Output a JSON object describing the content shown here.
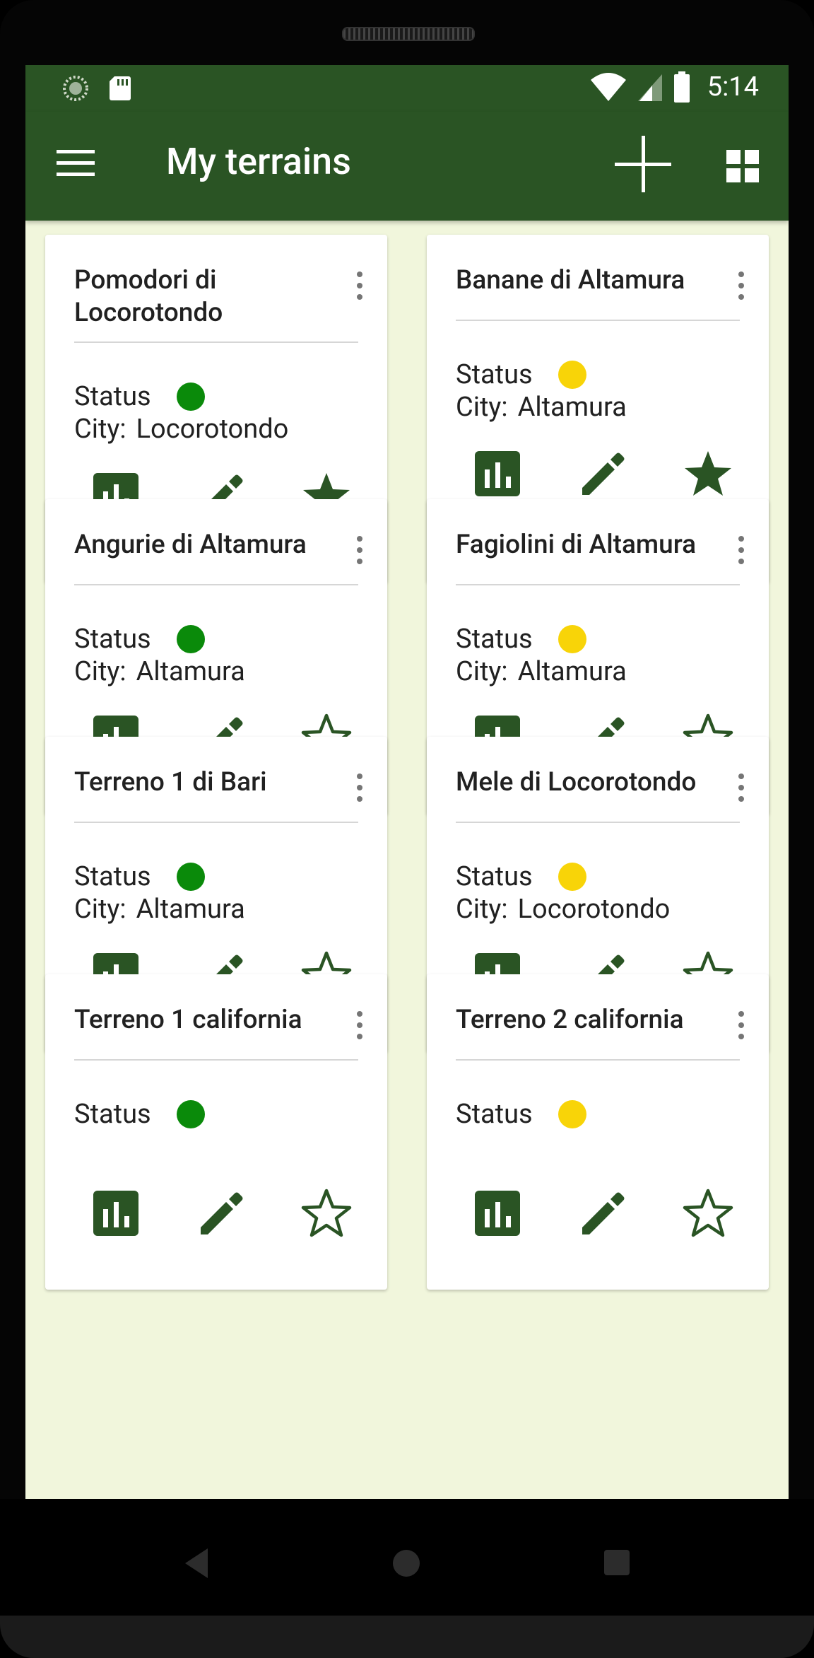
{
  "statusbar": {
    "time": "5:14"
  },
  "appbar": {
    "title": "My terrains"
  },
  "colors": {
    "primary": "#2a5424",
    "background": "#f1f6dc",
    "status_green": "#0a8a0a",
    "status_yellow": "#f8d408",
    "icon": "#2a5424"
  },
  "labels": {
    "status": "Status",
    "city": "City:"
  },
  "terrains": [
    {
      "title": "Pomodori di Locorotondo",
      "status": "green",
      "city": "Locorotondo",
      "favorite": true
    },
    {
      "title": "Banane di Altamura",
      "status": "yellow",
      "city": "Altamura",
      "favorite": true
    },
    {
      "title": "Angurie di Altamura",
      "status": "green",
      "city": "Altamura",
      "favorite": false
    },
    {
      "title": "Fagiolini di Altamura",
      "status": "yellow",
      "city": "Altamura",
      "favorite": false
    },
    {
      "title": "Terreno 1 di Bari",
      "status": "green",
      "city": "Altamura",
      "favorite": false
    },
    {
      "title": "Mele di Locorotondo",
      "status": "yellow",
      "city": "Locorotondo",
      "favorite": false
    },
    {
      "title": "Terreno 1 california",
      "status": "green",
      "city": "",
      "favorite": false
    },
    {
      "title": "Terreno 2 california",
      "status": "yellow",
      "city": "",
      "favorite": false
    }
  ],
  "icons": {
    "menu": "hamburger-menu-icon",
    "add": "plus-icon",
    "view": "grid-view-icon",
    "chart": "bar-chart-icon",
    "edit": "pencil-icon",
    "favorite": "star-icon"
  }
}
